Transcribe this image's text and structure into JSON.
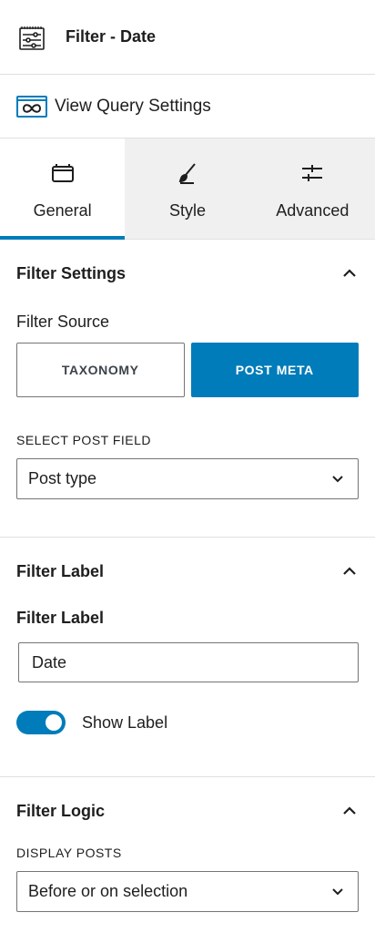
{
  "header": {
    "title": "Filter - Date",
    "icon": "filter-sliders-icon"
  },
  "query_link": {
    "label": "View Query Settings",
    "icon": "query-loop-icon"
  },
  "tabs": [
    {
      "label": "General",
      "icon": "window-icon",
      "active": true
    },
    {
      "label": "Style",
      "icon": "brush-icon",
      "active": false
    },
    {
      "label": "Advanced",
      "icon": "sliders-icon",
      "active": false
    }
  ],
  "filter_settings": {
    "title": "Filter Settings",
    "source_label": "Filter Source",
    "source_options": [
      "TAXONOMY",
      "POST META"
    ],
    "source_selected": "POST META",
    "post_field_label": "SELECT POST FIELD",
    "post_field_value": "Post type"
  },
  "filter_label_panel": {
    "title": "Filter Label",
    "field_label": "Filter Label",
    "field_value": "Date",
    "toggle_label": "Show Label",
    "toggle_on": true
  },
  "filter_logic": {
    "title": "Filter Logic",
    "display_label": "DISPLAY POSTS",
    "display_value": "Before or on selection"
  },
  "colors": {
    "accent": "#007cba",
    "border": "#e0e0e0",
    "tab_inactive_bg": "#f0f0f0"
  }
}
